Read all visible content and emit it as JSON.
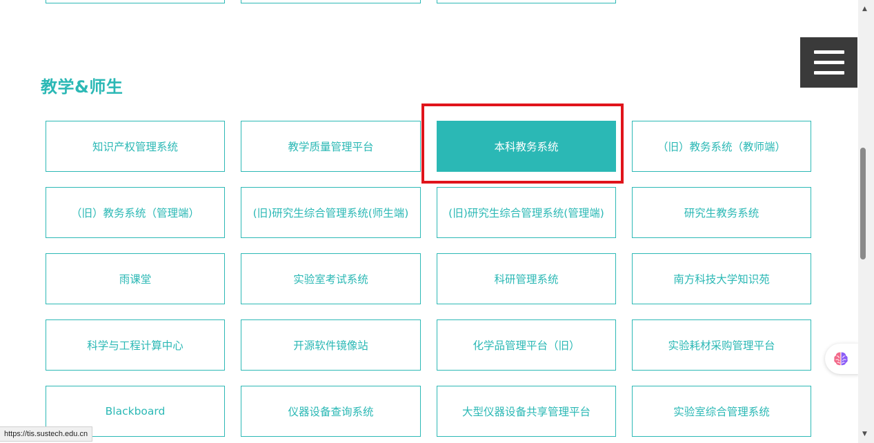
{
  "section": {
    "title": "教学&师生"
  },
  "cards": [
    "知识产权管理系统",
    "教学质量管理平台",
    "本科教务系统",
    "（旧）教务系统（教师端）",
    "（旧）教务系统（管理端）",
    "(旧)研究生综合管理系统(师生端)",
    "(旧)研究生综合管理系统(管理端)",
    "研究生教务系统",
    "雨课堂",
    "实验室考试系统",
    "科研管理系统",
    "南方科技大学知识苑",
    "科学与工程计算中心",
    "开源软件镜像站",
    "化学品管理平台（旧）",
    "实验耗材采购管理平台",
    "Blackboard",
    "仪器设备查询系统",
    "大型仪器设备共享管理平台",
    "实验室综合管理系统"
  ],
  "active_card": "本科教务系统",
  "status_bar": {
    "url": "https://tis.sustech.edu.cn"
  },
  "icons": {
    "menu": "hamburger-menu-icon",
    "assistant": "brain-icon",
    "scroll_up": "arrow-up-icon",
    "scroll_down": "arrow-down-icon"
  },
  "colors": {
    "accent": "#2bb8b5",
    "highlight": "#e0141b",
    "menu_bg": "#3a3a3a"
  }
}
